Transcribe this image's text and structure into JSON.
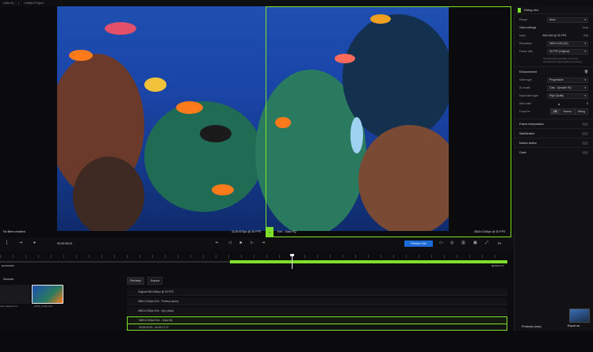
{
  "topbar": {
    "app": "Video AI",
    "project": "Untitled Project"
  },
  "stage": {
    "left_label": "No filters enabled",
    "center_left_res": "1120×576px @ 30 FPS",
    "center_right_res": "Enh - Gaia HQ",
    "right_res": "3840×2160px @ 30 FPS"
  },
  "panel": {
    "title": "Editing view",
    "preset_label": "Preset",
    "preset_value": "None",
    "video_settings": "Video settings",
    "crop": "Crop",
    "input_label": "Input",
    "input_value": "960×540 @ 30 FPS",
    "edit": "Edit",
    "resolution_label": "Resolution",
    "resolution_value": "3840×2160 (4K)",
    "frame_rate_label": "Frame rate",
    "frame_rate_value": "30 FPS (Original)",
    "note": "The Enhancement filter has been optimized for high-quality processing.",
    "enhancement": "Enhancement",
    "video_type_label": "Video type",
    "video_type_value": "Progressive",
    "ai_model_label": "AI model",
    "ai_model_value": "Gaia - Upscale HQ",
    "input_video_label": "Input video type",
    "input_video_value": "High Quality",
    "add_noise_label": "Add noise",
    "add_noise_value": "0",
    "focus_fix_label": "Focus fix",
    "focus_off": "Off",
    "focus_normal": "Normal",
    "focus_strong": "Strong",
    "frame_interpolation": "Frame interpolation",
    "stabilization": "Stabilization",
    "motion_deblur": "Motion deblur",
    "grain": "Grain"
  },
  "transport": {
    "timecode": "00:00:08:24",
    "preview_button": "Preview 1/2s",
    "zoom": "Fit"
  },
  "ruler": {
    "start": "00:00:00:00",
    "end": "00:00:17:17",
    "progress": 0.57
  },
  "sources": {
    "title": "Sources",
    "items": [
      {
        "name": "reef-original.mov"
      },
      {
        "name": "_4K50_small.mp4"
      }
    ]
  },
  "exports": {
    "tab_previews": "Previews",
    "tab_exports": "Exports",
    "rows": [
      "Original  960×540px @ 30 FPS",
      "3840×2160px  Enh - Proteus (Auto)",
      "3840×2160px  Enh - Nyx (Auto)",
      "3840×2160px  Enh - Gaia HQ",
      "00:00:00:00 - 00:00:17:17"
    ]
  },
  "footer": {
    "previews_label": "Previews (max)",
    "export_button": "Export as"
  },
  "colors": {
    "accent": "#7ee02a",
    "blue": "#1d6bd8"
  }
}
